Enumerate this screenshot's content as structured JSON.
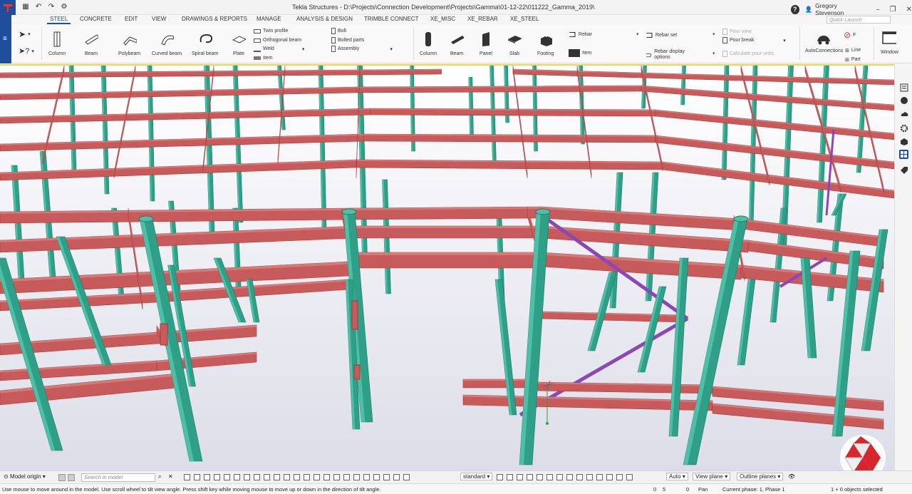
{
  "window": {
    "title": "Tekla Structures - D:\\Projects\\Connection Development\\Projects\\Gamma\\01-12-22\\011222_Gamma_2019\\",
    "user": "Gregory Stevenson",
    "quick_launch_placeholder": "Quick Launch"
  },
  "tabs": [
    {
      "label": "STEEL",
      "active": true
    },
    {
      "label": "CONCRETE",
      "active": false
    },
    {
      "label": "EDIT",
      "active": false
    },
    {
      "label": "VIEW",
      "active": false
    },
    {
      "label": "DRAWINGS & REPORTS",
      "active": false
    },
    {
      "label": "MANAGE",
      "active": false
    },
    {
      "label": "ANALYSIS & DESIGN",
      "active": false
    },
    {
      "label": "TRIMBLE CONNECT",
      "active": false
    },
    {
      "label": "XE_MISC",
      "active": false
    },
    {
      "label": "XE_REBAR",
      "active": false
    },
    {
      "label": "XE_STEEL",
      "active": false
    }
  ],
  "ribbon": {
    "steel": {
      "column": "Column",
      "beam": "Beam",
      "polybeam": "Polybeam",
      "curved_beam": "Curved beam",
      "spiral_beam": "Spiral beam",
      "plate": "Plate",
      "twin_profile": "Twin profile",
      "orthogonal_beam": "Orthogonal beam",
      "weld": "Weld",
      "item": "Item",
      "bolt": "Bolt",
      "bolted_parts": "Bolted parts",
      "assembly": "Assembly"
    },
    "concrete": {
      "column": "Column",
      "beam": "Beam",
      "panel": "Panel",
      "slab": "Slab",
      "footing": "Footing",
      "rebar": "Rebar",
      "item": "Item",
      "rebar_set": "Rebar set",
      "rebar_display_options": "Rebar display options",
      "pour_view": "Pour view",
      "pour_break": "Pour break",
      "calculate_pour_units": "Calculate pour units"
    },
    "autoconnection": "AutoConnections",
    "f_label": "F",
    "line": "Line",
    "part": "Part",
    "window": "Window"
  },
  "bottom_toolbar": {
    "model_origin": "Model origin",
    "search_placeholder": "Search in model",
    "view_filter": "standard",
    "auto": "Auto",
    "view_plane": "View plane",
    "outline_planes": "Outline planes"
  },
  "status": {
    "hint": "Use mouse to move around in the model. Use scroll wheel to tilt view angle. Press shift key while moving mouse to move up or down in the direction of tilt angle.",
    "coord1": "0",
    "coord2": "5",
    "coord3": "0",
    "mode": "Pan",
    "phase": "Current phase: 1, Phase 1",
    "selection": "1 + 0 objects selected"
  },
  "colors": {
    "beam": "#c75a5a",
    "column": "#2f9f88",
    "brace": "#8a47b5",
    "accent": "#1f4f9c"
  }
}
